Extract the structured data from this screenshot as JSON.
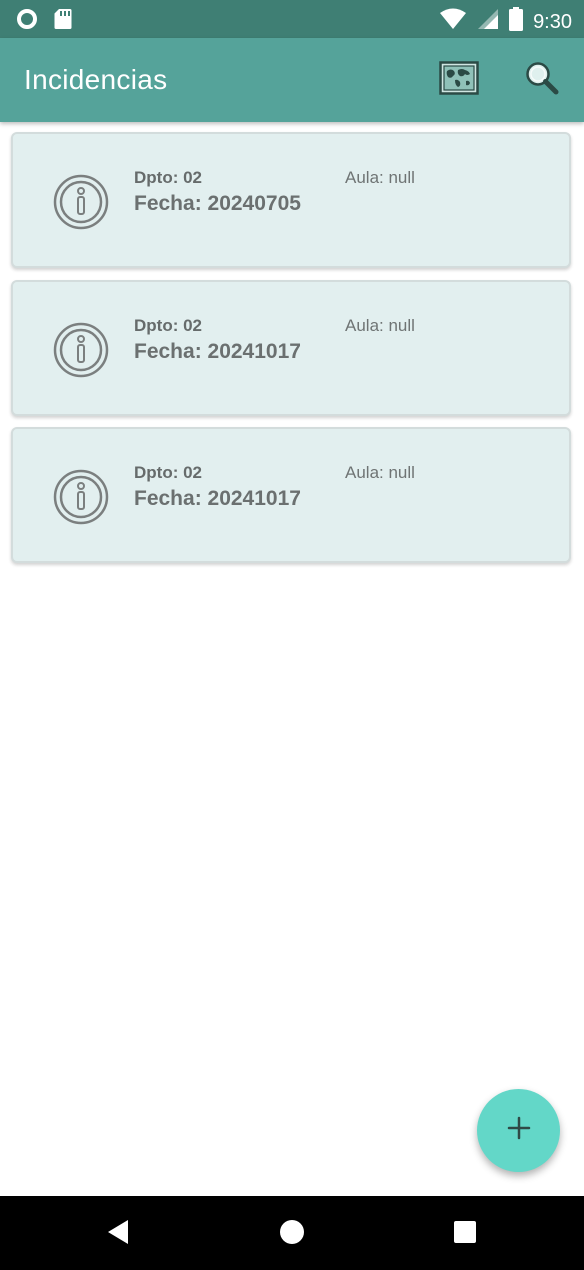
{
  "status_bar": {
    "time": "9:30",
    "left_icons": [
      "circle-notification-icon",
      "sd-card-icon"
    ],
    "right_icons": [
      "wifi-icon",
      "signal-icon",
      "battery-icon"
    ]
  },
  "app_bar": {
    "title": "Incidencias",
    "actions": [
      "map-icon",
      "search-icon"
    ]
  },
  "incidencias": [
    {
      "dpto": "Dpto: 02",
      "aula": "Aula: null",
      "fecha": "Fecha: 20240705"
    },
    {
      "dpto": "Dpto: 02",
      "aula": "Aula: null",
      "fecha": "Fecha: 20241017"
    },
    {
      "dpto": "Dpto: 02",
      "aula": "Aula: null",
      "fecha": "Fecha: 20241017"
    }
  ],
  "fab": {
    "icon": "plus-icon"
  },
  "nav_bar": {
    "buttons": [
      "back-icon",
      "home-icon",
      "recents-icon"
    ]
  },
  "colors": {
    "status_bar": "#3f7f74",
    "app_bar": "#55a39a",
    "card_bg": "#e2efef",
    "fab": "#63d7c8"
  }
}
